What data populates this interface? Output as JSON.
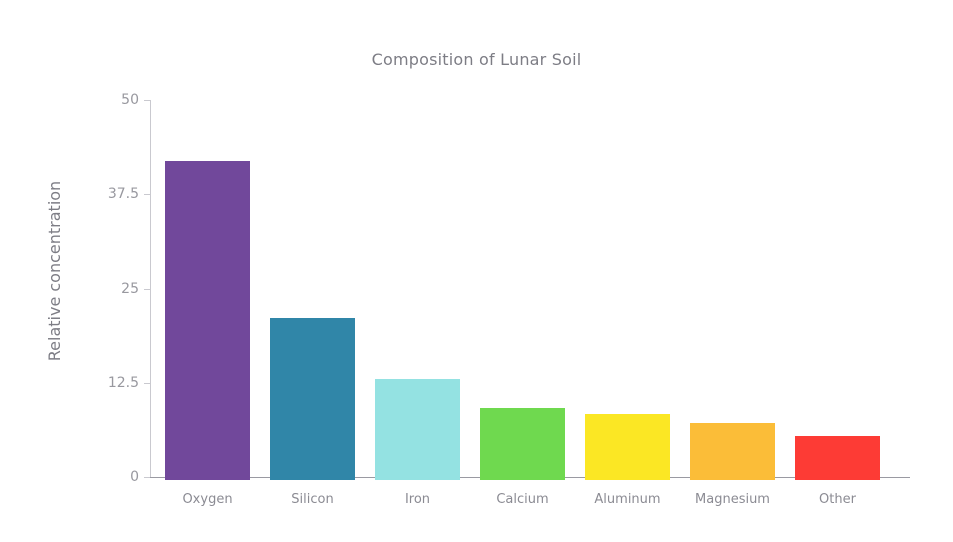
{
  "chart_data": {
    "type": "bar",
    "title": "Composition of Lunar Soil",
    "xlabel": "",
    "ylabel": "Relative concentration",
    "categories": [
      "Oxygen",
      "Silicon",
      "Iron",
      "Calcium",
      "Aluminum",
      "Magnesium",
      "Other"
    ],
    "values": [
      42.3,
      21.5,
      13.4,
      9.6,
      8.7,
      7.5,
      5.8
    ],
    "colors": [
      "#71489b",
      "#3086a8",
      "#94e2e2",
      "#6fd94f",
      "#fbe724",
      "#fbbd38",
      "#fd3b35"
    ],
    "ylim": [
      0,
      50
    ],
    "yticks": [
      0,
      12.5,
      25,
      37.5,
      50
    ],
    "ytick_labels": [
      "0",
      "12.5",
      "25",
      "37.5",
      "50"
    ],
    "grid": false,
    "legend": false
  },
  "axis": {
    "line_color": "#9a9aa2",
    "tick_color": "#c9c9cf",
    "label_color": "#98989f"
  },
  "title_color": "#7d7d85"
}
